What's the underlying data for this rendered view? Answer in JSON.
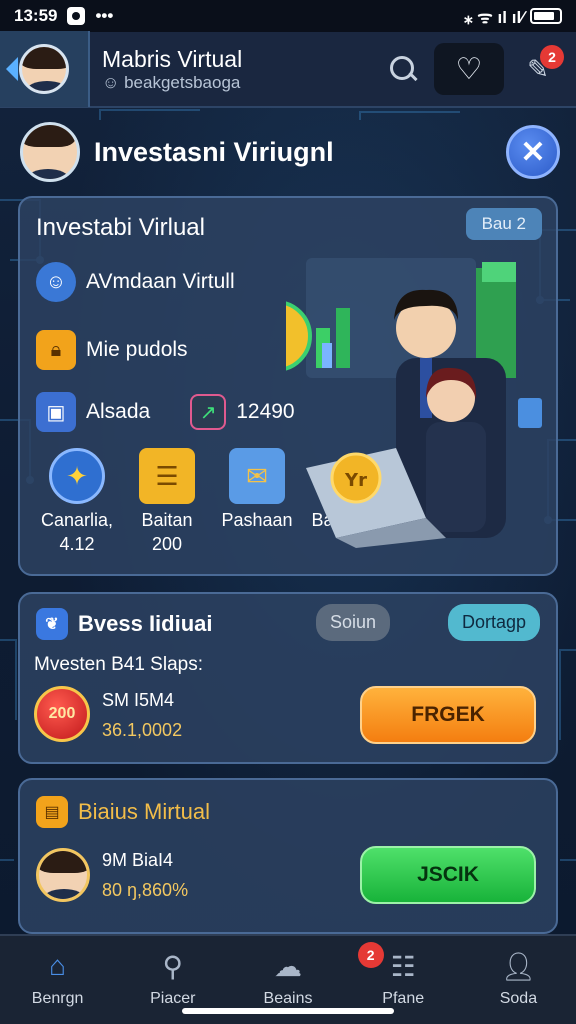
{
  "status": {
    "time": "13:59",
    "more": "•••",
    "icons": "⁎ ᯤ ıl ıl∕"
  },
  "header": {
    "title": "Mabris Virtual",
    "subtitle": "☺ beakgetsbaoga",
    "notif_count": "2"
  },
  "profile": {
    "name": "Investasni Viriugnl"
  },
  "main_card": {
    "title": "Investabi Virlual",
    "badge": "Bau 2",
    "menu": [
      {
        "label": "AVmdaan Virtull",
        "icon": "agent-icon"
      },
      {
        "label": "Mie pudols",
        "icon": "lock-icon"
      },
      {
        "label": "Alsada",
        "icon": "wallet-icon"
      }
    ],
    "stat_value": "12490",
    "grid": [
      {
        "line1": "Canarlia,",
        "line2": "4.12",
        "icon": "growth-icon"
      },
      {
        "line1": "Baitan",
        "line2": "200",
        "icon": "coins-icon"
      },
      {
        "line1": "Pashaan",
        "line2": "",
        "icon": "certificate-icon"
      },
      {
        "line1": "Banirion,",
        "line2": "",
        "icon": "handshake-icon"
      }
    ],
    "coin_label": "≠",
    "coin2_label": "Yr"
  },
  "invest_card": {
    "title": "Bvess Iidiuai",
    "chip_left": "Soiun",
    "chip_right": "Dortagp",
    "subtitle": "Mvesten B41 Slaps:",
    "coin_text": "200",
    "stat_a": "SM I5M4",
    "stat_b": "36.1,0002",
    "button": "FRGEK"
  },
  "market_card": {
    "title": "Biaius Mirtual",
    "stat_a": "9M BiaI4",
    "stat_b": "80 ŋ,860%",
    "button": "JSCIK"
  },
  "nav": [
    {
      "label": "Benrgn",
      "icon": "home-icon",
      "active": true
    },
    {
      "label": "Piacer",
      "icon": "search-people-icon",
      "active": false
    },
    {
      "label": "Beains",
      "icon": "cloud-icon",
      "active": false
    },
    {
      "label": "Pfane",
      "icon": "list-icon",
      "active": false,
      "badge": "2"
    },
    {
      "label": "Soda",
      "icon": "user-icon",
      "active": false
    }
  ],
  "colors": {
    "accent": "#4a8fe7",
    "orange": "#f47e10",
    "green": "#18b33a",
    "card": "#2d4262"
  }
}
